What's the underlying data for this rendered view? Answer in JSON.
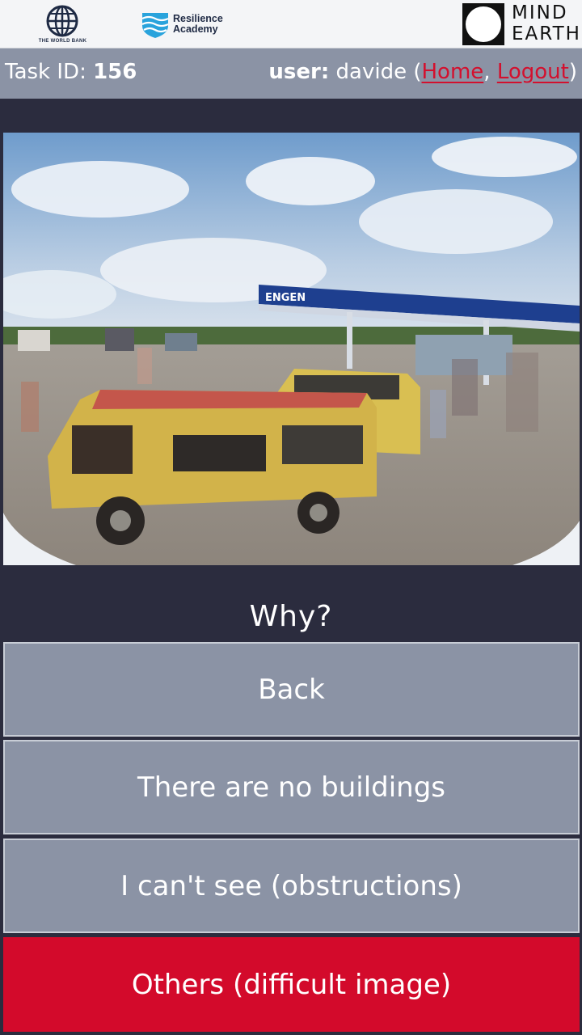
{
  "logos": {
    "world_bank": "THE WORLD BANK",
    "resilience_academy_line1": "Resilience",
    "resilience_academy_line2": "Academy",
    "mind_earth_line1": "MIND",
    "mind_earth_line2": "EARTH"
  },
  "header": {
    "task_label": "Task ID: ",
    "task_id": "156",
    "user_label": "user:",
    "username": " davide (",
    "home_link": "Home",
    "separator": ", ",
    "logout_link": "Logout",
    "close_paren": ")"
  },
  "photo": {
    "station_sign": "ENGEN"
  },
  "question": "Why?",
  "answers": [
    {
      "label": "Back"
    },
    {
      "label": "There are no buildings"
    },
    {
      "label": "I can't see (obstructions)"
    },
    {
      "label": "Others (difficult image)"
    }
  ],
  "colors": {
    "background": "#2b2c3e",
    "panel": "#8b93a5",
    "accent_red": "#d30a2b",
    "link_red": "#d3102e"
  }
}
